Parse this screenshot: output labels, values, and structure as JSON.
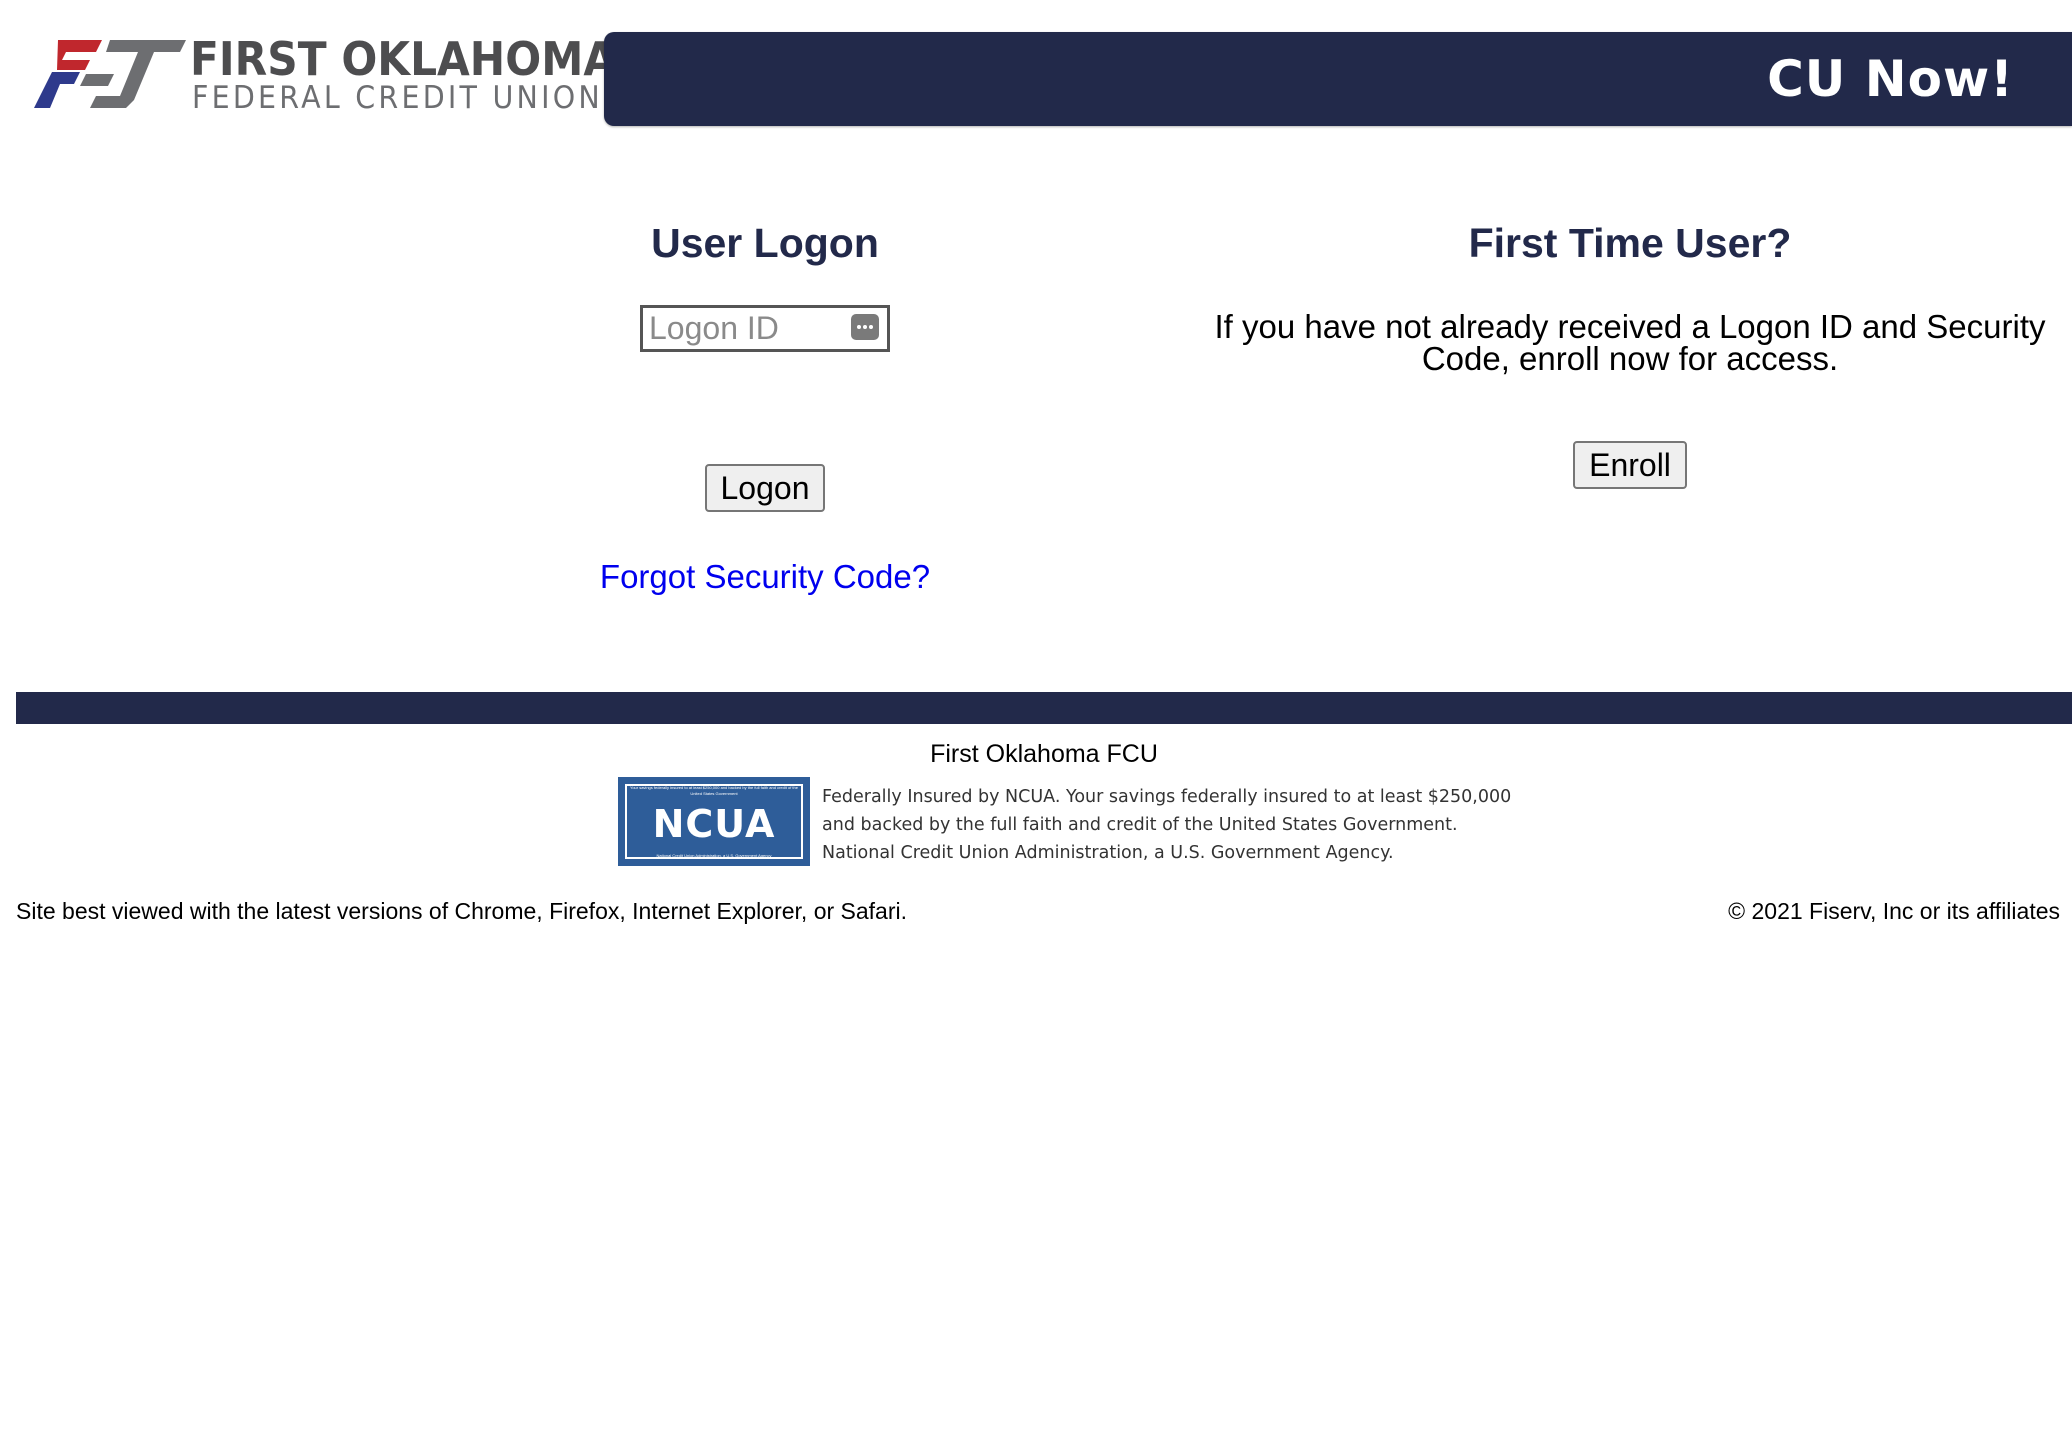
{
  "header": {
    "logo": {
      "line1": "FIRST OKLAHOMA",
      "line2": "FEDERAL CREDIT UNION",
      "colors": {
        "red": "#c0272d",
        "blue": "#2e3a8c",
        "gray": "#6d6e71"
      }
    },
    "banner_text": "CU Now!",
    "banner_color": "#22294a"
  },
  "logon": {
    "heading": "User Logon",
    "logon_id_placeholder": "Logon ID",
    "logon_id_value": "",
    "key_icon": "password-manager-icon",
    "logon_button": "Logon",
    "forgot_link": "Forgot Security Code?"
  },
  "enroll": {
    "heading": "First Time User?",
    "description": "If you have not already received a Logon ID and Security Code, enroll now for access.",
    "enroll_button": "Enroll"
  },
  "footer": {
    "institution_name": "First Oklahoma FCU",
    "ncua": {
      "badge_small_top": "Your savings federally insured to at least $250,000 and backed by the full faith and credit of the United States Government",
      "badge_title": "NCUA",
      "badge_small_bottom": "National Credit Union Administration, a U.S. Government Agency",
      "line1": "Federally Insured by NCUA. Your savings federally insured to at least $250,000",
      "line2": "and backed by the full faith and credit of the United States Government.",
      "line3": "National Credit Union Administration, a U.S. Government Agency."
    },
    "browser_note": "Site best viewed with the latest versions of Chrome, Firefox, Internet Explorer, or Safari.",
    "copyright": "© 2021 Fiserv, Inc or its affiliates"
  }
}
